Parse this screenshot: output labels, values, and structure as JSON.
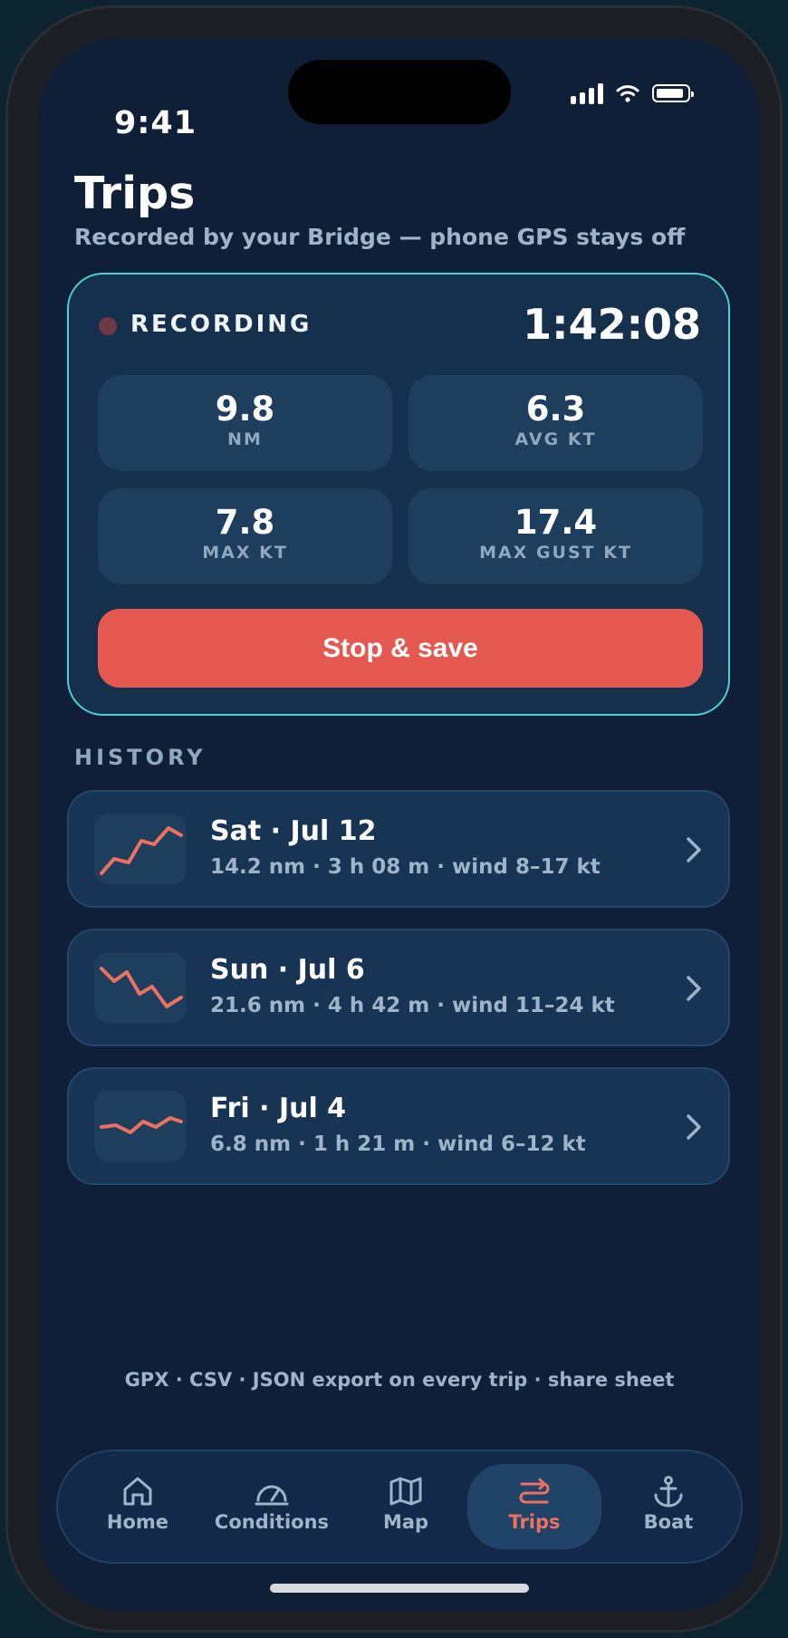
{
  "status_bar": {
    "time": "9:41"
  },
  "page": {
    "title": "Trips",
    "subtitle": "Recorded by your Bridge — phone GPS stays off"
  },
  "recording": {
    "label": "RECORDING",
    "elapsed": "1:42:08",
    "stats": [
      {
        "value": "9.8",
        "unit": "NM"
      },
      {
        "value": "6.3",
        "unit": "AVG KT"
      },
      {
        "value": "7.8",
        "unit": "MAX KT"
      },
      {
        "value": "17.4",
        "unit": "MAX GUST KT"
      }
    ],
    "stop_label": "Stop & save"
  },
  "history": {
    "label": "HISTORY",
    "trips": [
      {
        "title": "Sat · Jul 12",
        "meta": "14.2 nm · 3 h 08 m · wind 8–17 kt",
        "sparkline_icon": "trend-up-sparkline"
      },
      {
        "title": "Sun · Jul 6",
        "meta": "21.6 nm · 4 h 42 m · wind 11–24 kt",
        "sparkline_icon": "trend-down-sparkline"
      },
      {
        "title": "Fri · Jul 4",
        "meta": "6.8 nm · 1 h 21 m · wind 6–12 kt",
        "sparkline_icon": "flat-sparkline"
      }
    ]
  },
  "export_note": "GPX · CSV · JSON export on every trip · share sheet",
  "tabbar": {
    "tabs": [
      {
        "label": "Home",
        "icon": "home-icon"
      },
      {
        "label": "Conditions",
        "icon": "gauge-icon"
      },
      {
        "label": "Map",
        "icon": "map-icon"
      },
      {
        "label": "Trips",
        "icon": "route-icon",
        "active": true
      },
      {
        "label": "Boat",
        "icon": "anchor-icon"
      }
    ]
  },
  "colors": {
    "background": "#0e1f37",
    "accent": "#e5584f",
    "card_border": "#4fd1d1",
    "active_tab_text": "#ee7061"
  }
}
